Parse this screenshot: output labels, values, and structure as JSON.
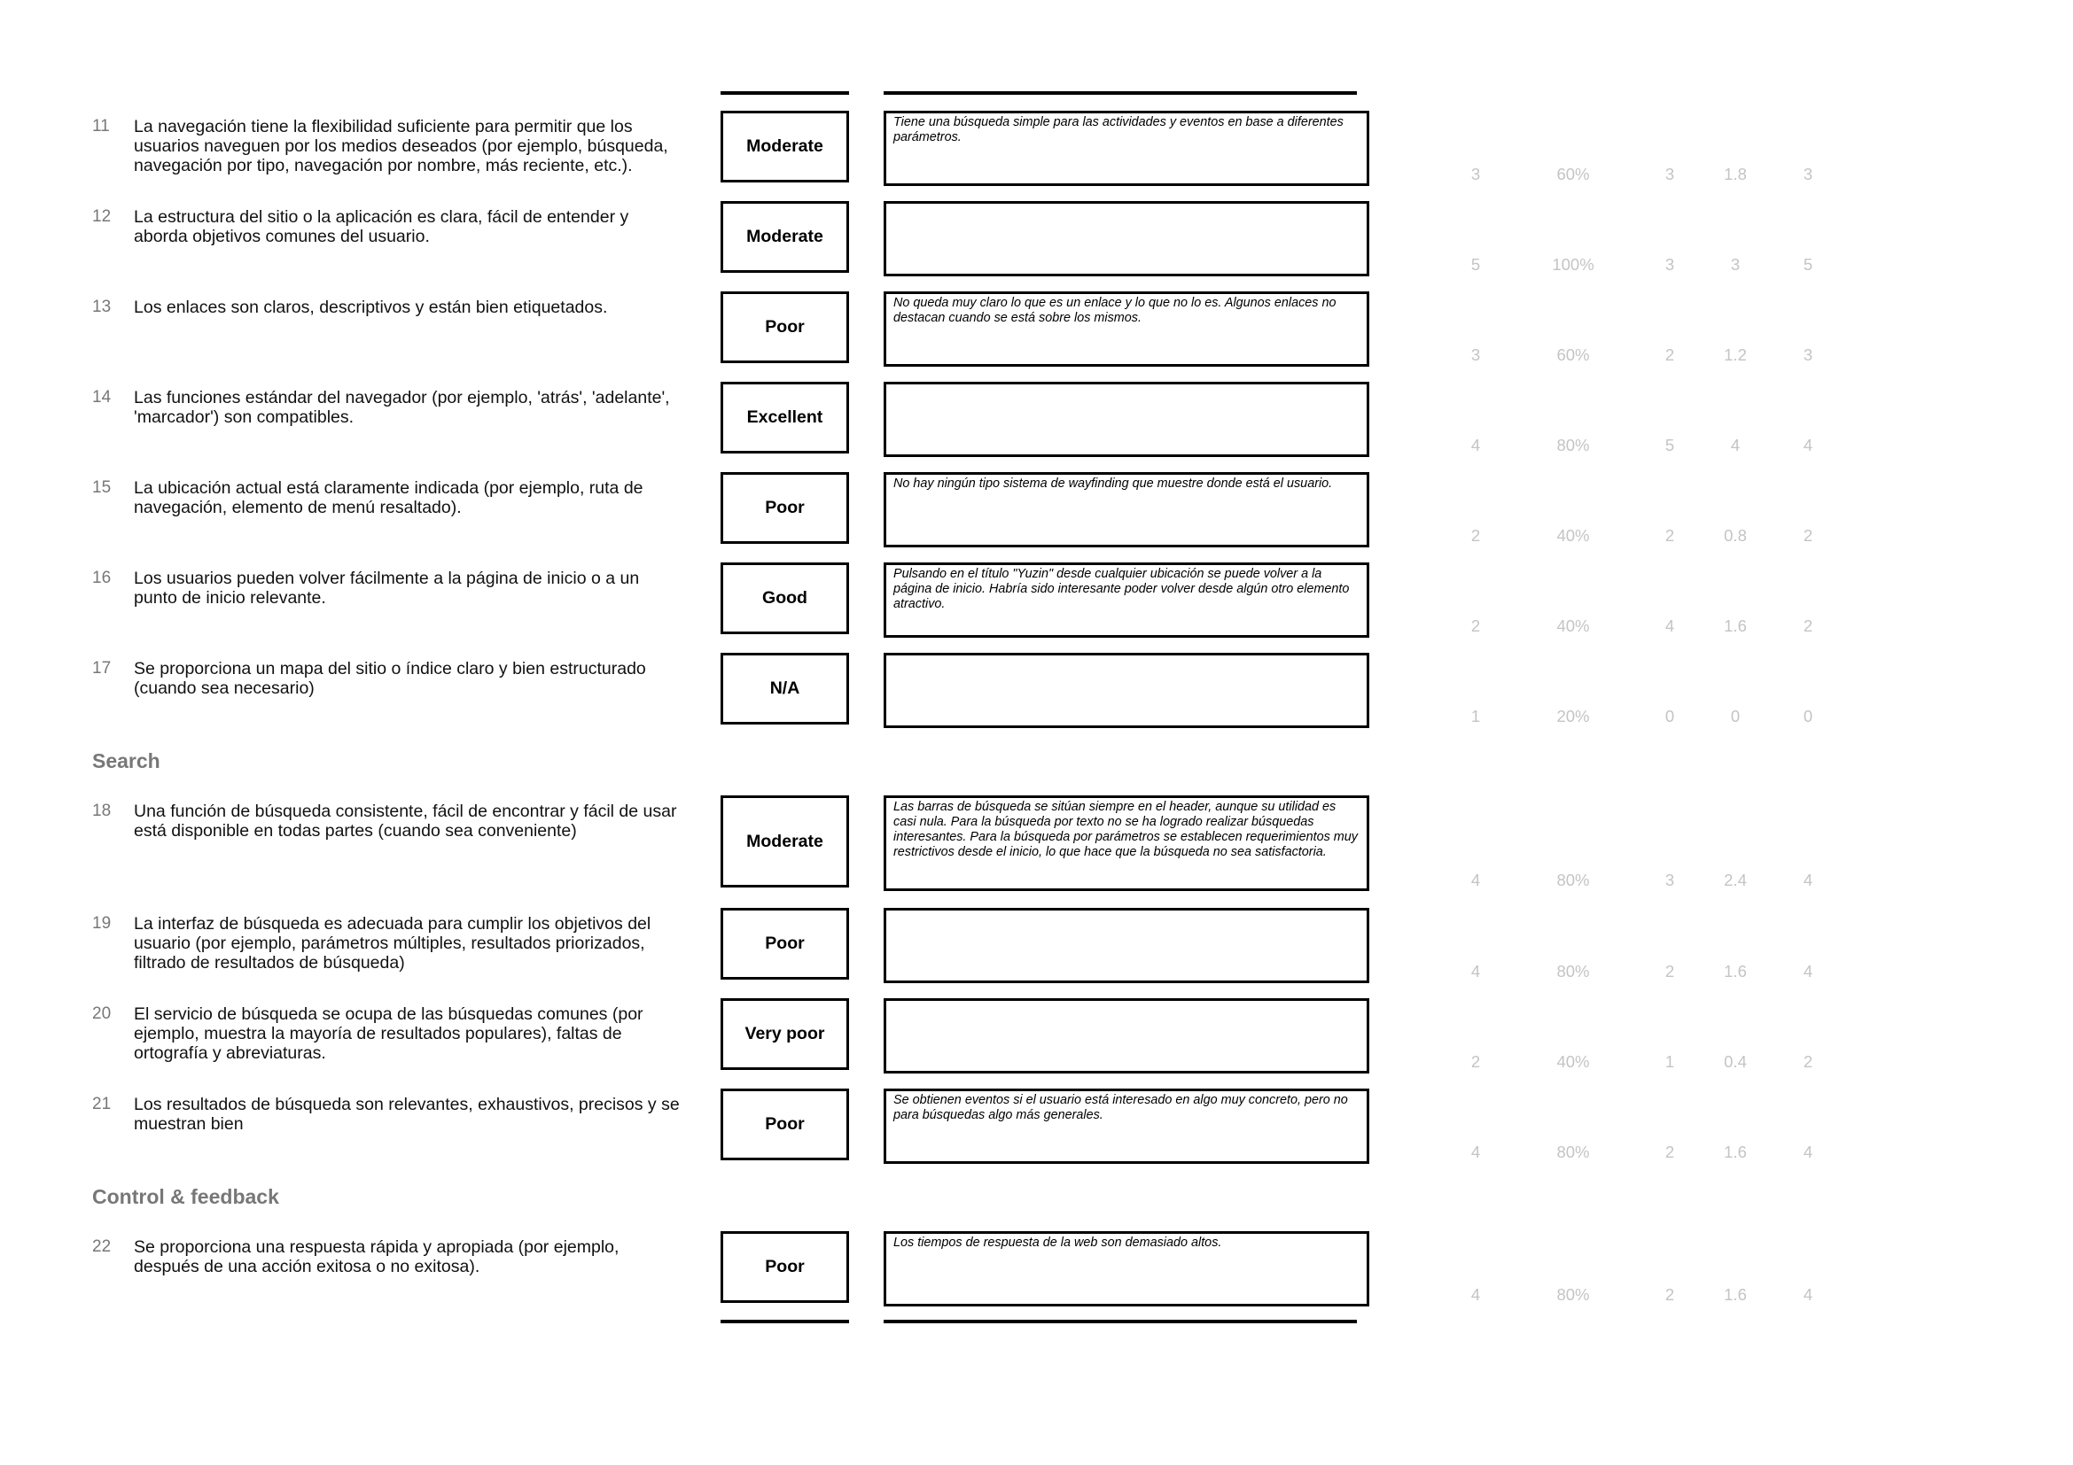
{
  "sections": {
    "search": "Search",
    "control": "Control & feedback"
  },
  "rows": [
    {
      "num": "11",
      "question": "La navegación tiene la flexibilidad suficiente para permitir que los usuarios naveguen por los medios deseados (por ejemplo, búsqueda, navegación por tipo, navegación por nombre, más reciente, etc.).",
      "rating": "Moderate",
      "comment": "Tiene una búsqueda simple para las actividades y eventos en base a diferentes parámetros.",
      "stats": [
        "3",
        "60%",
        "3",
        "1.8",
        "3"
      ]
    },
    {
      "num": "12",
      "question": "La estructura del sitio o la aplicación es clara, fácil de entender y aborda objetivos comunes del usuario.",
      "rating": "Moderate",
      "comment": "",
      "stats": [
        "5",
        "100%",
        "3",
        "3",
        "5"
      ]
    },
    {
      "num": "13",
      "question": "Los enlaces son claros, descriptivos y están bien etiquetados.",
      "rating": "Poor",
      "comment": "No queda muy claro lo que es un enlace y lo que no lo es. Algunos enlaces no destacan cuando se está sobre los mismos.",
      "stats": [
        "3",
        "60%",
        "2",
        "1.2",
        "3"
      ]
    },
    {
      "num": "14",
      "question": "Las funciones estándar del navegador (por ejemplo, 'atrás', 'adelante', 'marcador') son compatibles.",
      "rating": "Excellent",
      "comment": "",
      "stats": [
        "4",
        "80%",
        "5",
        "4",
        "4"
      ]
    },
    {
      "num": "15",
      "question": "La ubicación actual está claramente indicada (por ejemplo, ruta de navegación, elemento de menú resaltado).",
      "rating": "Poor",
      "comment": "No hay ningún tipo sistema de wayfinding que muestre donde está el usuario.",
      "stats": [
        "2",
        "40%",
        "2",
        "0.8",
        "2"
      ]
    },
    {
      "num": "16",
      "question": "Los usuarios pueden volver fácilmente a la página de inicio o a un punto de inicio relevante.",
      "rating": "Good",
      "comment": "Pulsando en el título \"Yuzin\" desde cualquier ubicación se puede volver a la página de inicio. Habría sido interesante poder volver desde algún otro elemento atractivo.",
      "stats": [
        "2",
        "40%",
        "4",
        "1.6",
        "2"
      ]
    },
    {
      "num": "17",
      "question": "Se proporciona un mapa del sitio o índice claro y bien estructurado (cuando sea necesario)",
      "rating": "N/A",
      "comment": "",
      "stats": [
        "1",
        "20%",
        "0",
        "0",
        "0"
      ]
    },
    {
      "num": "18",
      "question": "Una función de búsqueda consistente, fácil de encontrar y fácil de usar está disponible en todas partes (cuando sea conveniente)",
      "rating": "Moderate",
      "comment": "Las barras de búsqueda se sitúan siempre en el header, aunque su utilidad es casi nula. Para la búsqueda por texto no se ha logrado realizar búsquedas interesantes. Para la búsqueda por parámetros se establecen requerimientos muy restrictivos desde el inicio, lo que hace que la búsqueda no sea satisfactoria.",
      "stats": [
        "4",
        "80%",
        "3",
        "2.4",
        "4"
      ]
    },
    {
      "num": "19",
      "question": "La interfaz de búsqueda es adecuada para cumplir los objetivos del usuario (por ejemplo, parámetros múltiples, resultados priorizados, filtrado de resultados de búsqueda)",
      "rating": "Poor",
      "comment": "",
      "stats": [
        "4",
        "80%",
        "2",
        "1.6",
        "4"
      ]
    },
    {
      "num": "20",
      "question": "El servicio de búsqueda se ocupa de las búsquedas comunes (por ejemplo, muestra la mayoría de resultados populares), faltas de ortografía y abreviaturas.",
      "rating": "Very poor",
      "comment": "",
      "stats": [
        "2",
        "40%",
        "1",
        "0.4",
        "2"
      ]
    },
    {
      "num": "21",
      "question": "Los resultados de búsqueda son relevantes, exhaustivos, precisos y se muestran bien",
      "rating": "Poor",
      "comment": "Se obtienen eventos si el usuario está interesado en algo muy concreto, pero no para búsquedas algo más generales.",
      "stats": [
        "4",
        "80%",
        "2",
        "1.6",
        "4"
      ]
    },
    {
      "num": "22",
      "question": "Se proporciona una respuesta rápida y apropiada (por ejemplo, después de una acción exitosa o no exitosa).",
      "rating": "Poor",
      "comment": "Los tiempos de respuesta de la web son demasiado altos.",
      "stats": [
        "4",
        "80%",
        "2",
        "1.6",
        "4"
      ]
    }
  ]
}
